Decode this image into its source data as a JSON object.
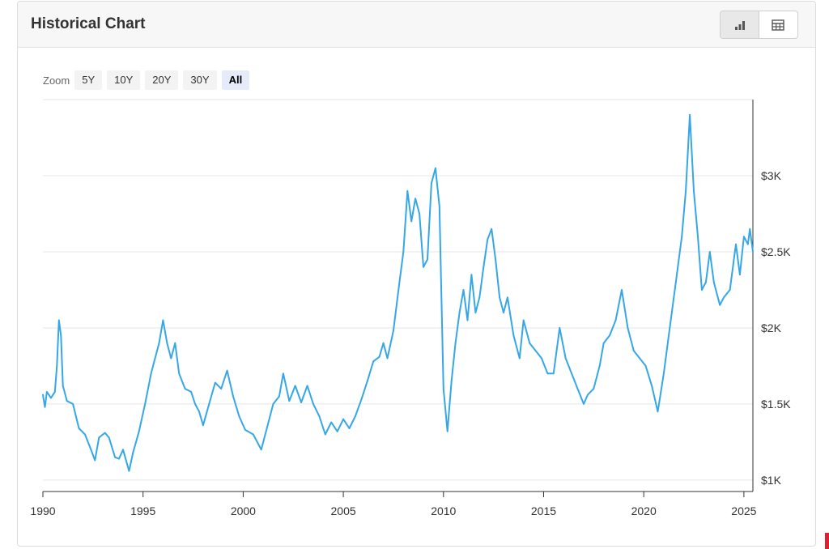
{
  "header": {
    "title": "Historical Chart"
  },
  "view_toggle": {
    "active": "chart",
    "chart_icon": "bar-chart-icon",
    "table_icon": "table-icon"
  },
  "zoom": {
    "label": "Zoom",
    "options": [
      "5Y",
      "10Y",
      "20Y",
      "30Y",
      "All"
    ],
    "active": "All"
  },
  "colors": {
    "line": "#35a7e8",
    "grid": "#e6e6e6",
    "axis": "#333333",
    "active_zoom_bg": "#e6ebfa"
  },
  "chart_data": {
    "type": "line",
    "title": "",
    "xlabel": "",
    "ylabel": "",
    "x_ticks": [
      "1990",
      "1995",
      "2000",
      "2005",
      "2010",
      "2015",
      "2020",
      "2025"
    ],
    "y_ticks": [
      "$1K",
      "$1.5K",
      "$2K",
      "$2.5K",
      "$3K"
    ],
    "xlim": [
      1990,
      2025.45
    ],
    "ylim": [
      925,
      3500
    ],
    "y_axis_side": "right",
    "grid": true,
    "legend": "none",
    "series": [
      {
        "values": [
          [
            1990.0,
            1560
          ],
          [
            1990.1,
            1480
          ],
          [
            1990.2,
            1580
          ],
          [
            1990.4,
            1540
          ],
          [
            1990.6,
            1580
          ],
          [
            1990.7,
            1750
          ],
          [
            1990.8,
            2050
          ],
          [
            1990.9,
            1950
          ],
          [
            1991.0,
            1620
          ],
          [
            1991.2,
            1520
          ],
          [
            1991.5,
            1500
          ],
          [
            1991.8,
            1340
          ],
          [
            1992.1,
            1300
          ],
          [
            1992.4,
            1200
          ],
          [
            1992.6,
            1130
          ],
          [
            1992.8,
            1280
          ],
          [
            1993.1,
            1310
          ],
          [
            1993.3,
            1280
          ],
          [
            1993.6,
            1150
          ],
          [
            1993.8,
            1140
          ],
          [
            1994.0,
            1200
          ],
          [
            1994.3,
            1060
          ],
          [
            1994.5,
            1180
          ],
          [
            1994.8,
            1320
          ],
          [
            1995.1,
            1500
          ],
          [
            1995.4,
            1700
          ],
          [
            1995.8,
            1900
          ],
          [
            1996.0,
            2050
          ],
          [
            1996.2,
            1900
          ],
          [
            1996.4,
            1800
          ],
          [
            1996.6,
            1900
          ],
          [
            1996.8,
            1700
          ],
          [
            1997.1,
            1600
          ],
          [
            1997.4,
            1580
          ],
          [
            1997.6,
            1500
          ],
          [
            1997.8,
            1450
          ],
          [
            1998.0,
            1360
          ],
          [
            1998.3,
            1500
          ],
          [
            1998.6,
            1640
          ],
          [
            1998.9,
            1600
          ],
          [
            1999.2,
            1720
          ],
          [
            1999.5,
            1550
          ],
          [
            1999.8,
            1420
          ],
          [
            2000.1,
            1330
          ],
          [
            2000.5,
            1300
          ],
          [
            2000.9,
            1200
          ],
          [
            2001.2,
            1350
          ],
          [
            2001.5,
            1500
          ],
          [
            2001.8,
            1550
          ],
          [
            2002.0,
            1700
          ],
          [
            2002.3,
            1520
          ],
          [
            2002.6,
            1620
          ],
          [
            2002.9,
            1510
          ],
          [
            2003.2,
            1620
          ],
          [
            2003.5,
            1500
          ],
          [
            2003.8,
            1420
          ],
          [
            2004.1,
            1300
          ],
          [
            2004.4,
            1380
          ],
          [
            2004.7,
            1320
          ],
          [
            2005.0,
            1400
          ],
          [
            2005.3,
            1340
          ],
          [
            2005.6,
            1420
          ],
          [
            2005.9,
            1530
          ],
          [
            2006.2,
            1650
          ],
          [
            2006.5,
            1780
          ],
          [
            2006.8,
            1810
          ],
          [
            2007.0,
            1900
          ],
          [
            2007.2,
            1800
          ],
          [
            2007.5,
            1980
          ],
          [
            2007.8,
            2300
          ],
          [
            2008.0,
            2500
          ],
          [
            2008.2,
            2900
          ],
          [
            2008.4,
            2700
          ],
          [
            2008.6,
            2850
          ],
          [
            2008.8,
            2750
          ],
          [
            2009.0,
            2400
          ],
          [
            2009.2,
            2450
          ],
          [
            2009.4,
            2950
          ],
          [
            2009.6,
            3050
          ],
          [
            2009.8,
            2800
          ],
          [
            2010.0,
            1600
          ],
          [
            2010.2,
            1320
          ],
          [
            2010.4,
            1650
          ],
          [
            2010.6,
            1900
          ],
          [
            2010.8,
            2100
          ],
          [
            2011.0,
            2250
          ],
          [
            2011.2,
            2050
          ],
          [
            2011.4,
            2350
          ],
          [
            2011.6,
            2100
          ],
          [
            2011.8,
            2200
          ],
          [
            2012.0,
            2400
          ],
          [
            2012.2,
            2580
          ],
          [
            2012.4,
            2650
          ],
          [
            2012.6,
            2450
          ],
          [
            2012.8,
            2200
          ],
          [
            2013.0,
            2100
          ],
          [
            2013.2,
            2200
          ],
          [
            2013.5,
            1950
          ],
          [
            2013.8,
            1800
          ],
          [
            2014.0,
            2050
          ],
          [
            2014.3,
            1900
          ],
          [
            2014.6,
            1850
          ],
          [
            2014.9,
            1800
          ],
          [
            2015.2,
            1700
          ],
          [
            2015.5,
            1700
          ],
          [
            2015.8,
            2000
          ],
          [
            2016.1,
            1800
          ],
          [
            2016.4,
            1700
          ],
          [
            2016.7,
            1600
          ],
          [
            2017.0,
            1500
          ],
          [
            2017.2,
            1560
          ],
          [
            2017.5,
            1600
          ],
          [
            2017.8,
            1750
          ],
          [
            2018.0,
            1900
          ],
          [
            2018.3,
            1950
          ],
          [
            2018.6,
            2050
          ],
          [
            2018.9,
            2250
          ],
          [
            2019.2,
            2000
          ],
          [
            2019.5,
            1850
          ],
          [
            2019.8,
            1800
          ],
          [
            2020.1,
            1750
          ],
          [
            2020.4,
            1620
          ],
          [
            2020.7,
            1450
          ],
          [
            2021.0,
            1700
          ],
          [
            2021.3,
            2000
          ],
          [
            2021.6,
            2300
          ],
          [
            2021.9,
            2600
          ],
          [
            2022.1,
            2900
          ],
          [
            2022.3,
            3400
          ],
          [
            2022.5,
            2900
          ],
          [
            2022.7,
            2600
          ],
          [
            2022.9,
            2250
          ],
          [
            2023.1,
            2300
          ],
          [
            2023.3,
            2500
          ],
          [
            2023.5,
            2300
          ],
          [
            2023.8,
            2150
          ],
          [
            2024.0,
            2200
          ],
          [
            2024.3,
            2250
          ],
          [
            2024.6,
            2550
          ],
          [
            2024.8,
            2350
          ],
          [
            2025.0,
            2600
          ],
          [
            2025.2,
            2550
          ],
          [
            2025.3,
            2650
          ],
          [
            2025.45,
            2500
          ]
        ]
      }
    ]
  }
}
